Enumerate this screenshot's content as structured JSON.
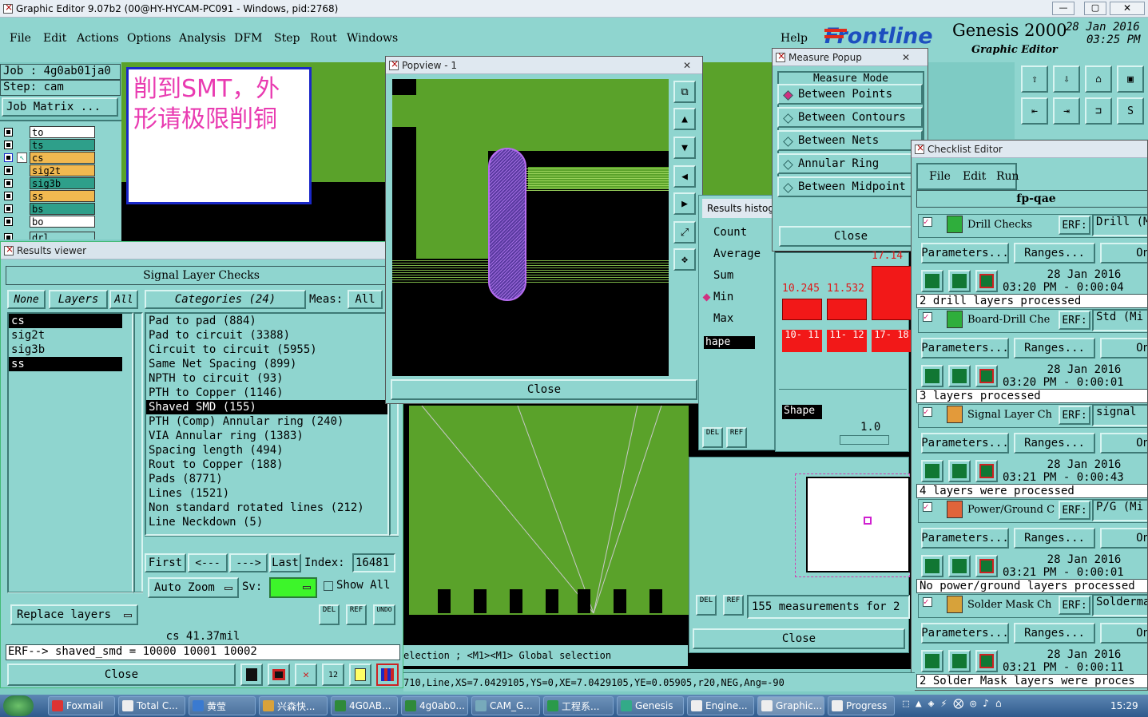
{
  "window": {
    "title": "Graphic Editor 9.07b2 (00@HY-HYCAM-PC091 - Windows, pid:2768)"
  },
  "menu": {
    "items": [
      "File",
      "Edit",
      "Actions",
      "Options",
      "Analysis",
      "DFM",
      "Step",
      "Rout",
      "Windows"
    ],
    "help": "Help"
  },
  "brand": {
    "logo": "Frontline",
    "product": "Genesis 2000",
    "subtitle": "Graphic Editor",
    "date": "28 Jan 2016",
    "time": "03:25 PM"
  },
  "job": {
    "job_label": "Job : 4g0ab01ja0",
    "step_label": "Step: cam",
    "matrix_button": "Job Matrix ..."
  },
  "note": {
    "text_line1": "削到SMT，外",
    "text_line2": "形请极限削铜"
  },
  "layers": [
    {
      "name": "to",
      "color": "#ffffff"
    },
    {
      "name": "ts",
      "color": "#2e9f8a"
    },
    {
      "name": "cs",
      "color": "#f1b950"
    },
    {
      "name": "sig2t",
      "color": "#f1b950"
    },
    {
      "name": "sig3b",
      "color": "#2e9f8a"
    },
    {
      "name": "ss",
      "color": "#f1b950"
    },
    {
      "name": "bs",
      "color": "#2e9f8a"
    },
    {
      "name": "bo",
      "color": "#ffffff"
    },
    {
      "name": "drl",
      "color": "#8fd5cf"
    }
  ],
  "results_viewer": {
    "title": "Results viewer",
    "header": "Signal Layer Checks",
    "none_btn": "None",
    "layers_btn": "Layers",
    "all_btn": "All",
    "categories_label": "Categories (24)",
    "meas_label": "Meas:",
    "meas_value": "All",
    "layer_list": [
      "cs",
      "sig2t",
      "sig3b",
      "ss"
    ],
    "categories": [
      "Pad to pad (884)",
      "Pad to circuit (3388)",
      "Circuit to circuit (5955)",
      "Same Net Spacing (899)",
      "NPTH to circuit (93)",
      "PTH to Copper (1146)",
      "Shaved SMD (155)",
      "PTH (Comp) Annular ring (240)",
      "VIA Annular ring (1383)",
      "Spacing length (494)",
      "Rout to Copper (188)",
      "Pads (8771)",
      "Lines (1521)",
      "Non standard rotated lines (212)",
      "Line Neckdown (5)"
    ],
    "selected_category": "Shaved SMD (155)",
    "first_btn": "First",
    "prev_btn": "<---",
    "next_btn": "--->",
    "last_btn": "Last",
    "index_label": "Index:",
    "index_value": "16481",
    "auto_zoom": "Auto Zoom",
    "sv_label": "Sv:",
    "show_all": "Show All",
    "replace_layers": "Replace layers",
    "measure_value": "cs 41.37mil",
    "erf_line": "ERF--> shaved_smd = 10000 10001 10002",
    "close_btn": "Close",
    "del_btn": "DEL",
    "ref_btn": "REF",
    "undo_btn": "UNDO"
  },
  "popview": {
    "title": "Popview - 1",
    "close_btn": "Close"
  },
  "measure_popup": {
    "title": "Measure Popup",
    "header": "Measure Mode",
    "modes": [
      "Between Points",
      "Between Contours",
      "Between Nets",
      "Annular Ring",
      "Between Midpoint"
    ],
    "selected_mode": "Between Points",
    "close_btn": "Close"
  },
  "histogram": {
    "title": "Results histog",
    "stats": [
      "Count",
      "Average",
      "Sum",
      "Min",
      "Max"
    ],
    "selected_stat": "Min",
    "shape_label": "hape",
    "shape_btn": "Shape",
    "scale_value": "1.0",
    "bars": [
      {
        "value": "10.245",
        "range": "10- 11",
        "level": 0.45
      },
      {
        "value": "11.532",
        "range": "11- 12",
        "level": 0.45
      },
      {
        "value": "17.14",
        "range": "17- 18",
        "level": 1.0
      }
    ],
    "measurements_text": "155 measurements for 2",
    "close_btn": "Close"
  },
  "checklist": {
    "title": "Checklist Editor",
    "menu": [
      "File",
      "Edit",
      "Run"
    ],
    "name": "fp-qae",
    "checks": [
      {
        "name": "Drill Checks",
        "erf": "ERF:",
        "erf_value": "Drill (M",
        "date": "28 Jan 2016",
        "time": "03:20 PM - 0:00:04",
        "status": "2 drill layers processed",
        "icon_color": "#2fae3c"
      },
      {
        "name": "Board-Drill Che",
        "erf": "ERF:",
        "erf_value": "Std (Mi",
        "date": "28 Jan 2016",
        "time": "03:20 PM - 0:00:01",
        "status": "3 layers processed",
        "icon_color": "#2fae3c"
      },
      {
        "name": "Signal Layer Ch",
        "erf": "ERF:",
        "erf_value": "signal",
        "date": "28 Jan 2016",
        "time": "03:21 PM - 0:00:43",
        "status": "4 layers were processed",
        "icon_color": "#e39a3a"
      },
      {
        "name": "Power/Ground C",
        "erf": "ERF:",
        "erf_value": "P/G (Mi",
        "date": "28 Jan 2016",
        "time": "03:21 PM - 0:00:01",
        "status": "No power/ground layers processed",
        "icon_color": "#e0643a"
      },
      {
        "name": "Solder Mask Ch",
        "erf": "ERF:",
        "erf_value": "Solderma",
        "date": "28 Jan 2016",
        "time": "03:21 PM - 0:00:11",
        "status": "2 Solder Mask layers were proces",
        "icon_color": "#d7a23a"
      }
    ],
    "parameters_btn": "Parameters...",
    "ranges_btn": "Ranges...",
    "on_btn": "On"
  },
  "status": {
    "selection_hint": "election ; <M1><M1> Global selection",
    "feature_info": "710,Line,XS=7.0429105,YS=0,XE=7.0429105,YE=0.05905,r20,NEG,Ang=-90"
  },
  "taskbar": {
    "items": [
      "Foxmail",
      "Total C...",
      "黄莹",
      "兴森快...",
      "4G0AB...",
      "4g0ab0...",
      "CAM_G...",
      "工程系...",
      "Genesis",
      "Engine...",
      "Graphic...",
      "Progress"
    ],
    "clock": "15:29"
  }
}
